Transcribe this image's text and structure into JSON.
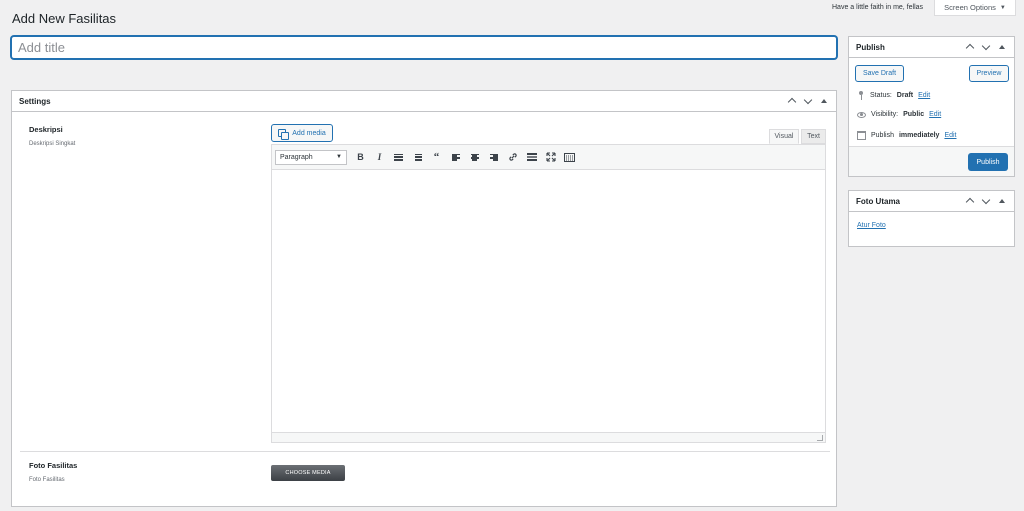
{
  "page": {
    "title": "Add New Fasilitas"
  },
  "topbar": {
    "hint": "Have a little faith in me, fellas",
    "screen_options": "Screen Options"
  },
  "title_field": {
    "placeholder": "Add title",
    "value": ""
  },
  "settings": {
    "title": "Settings",
    "deskripsi": {
      "label": "Deskripsi",
      "desc": "Deskripsi Singkat"
    },
    "editor": {
      "add_media": "Add media",
      "tabs": [
        "Visual",
        "Text"
      ],
      "format": "Paragraph",
      "buttons": [
        "bold",
        "italic",
        "bulleted-list",
        "numbered-list",
        "blockquote",
        "align-left",
        "align-center",
        "align-right",
        "link",
        "read-more",
        "fullscreen",
        "toolbar-toggle"
      ],
      "content": ""
    },
    "foto": {
      "label": "Foto Fasilitas",
      "desc": "Foto Fasilitas",
      "button": "CHOOSE MEDIA"
    }
  },
  "publish": {
    "title": "Publish",
    "save_draft": "Save Draft",
    "preview": "Preview",
    "status_label": "Status:",
    "status_value": "Draft",
    "visibility_label": "Visibility:",
    "visibility_value": "Public",
    "schedule_label": "Publish",
    "schedule_value": "immediately",
    "edit": "Edit",
    "publish_button": "Publish"
  },
  "foto_utama": {
    "title": "Foto Utama",
    "link": "Atur Foto"
  },
  "colors": {
    "accent": "#2271b1",
    "background": "#f0f0f1"
  }
}
